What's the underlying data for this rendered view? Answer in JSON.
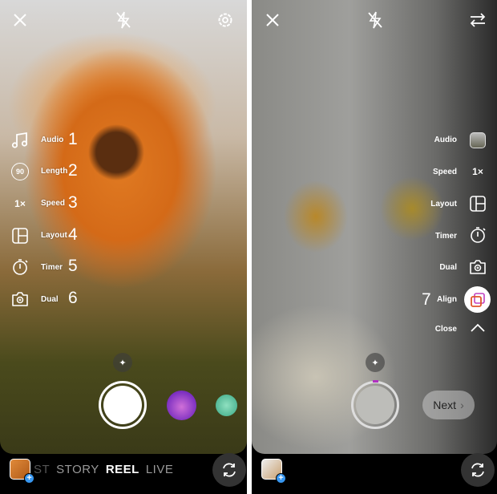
{
  "left": {
    "top_icons": [
      "close-icon",
      "flash-off-icon",
      "settings-icon"
    ],
    "tools": [
      {
        "icon": "music-note-icon",
        "label": "Audio",
        "number": "1"
      },
      {
        "icon": "length-icon",
        "icon_text": "90",
        "label": "Length",
        "number": "2"
      },
      {
        "icon": "speed-icon",
        "icon_text": "1×",
        "label": "Speed",
        "number": "3"
      },
      {
        "icon": "layout-icon",
        "label": "Layout",
        "number": "4"
      },
      {
        "icon": "timer-icon",
        "label": "Timer",
        "number": "5"
      },
      {
        "icon": "dual-camera-icon",
        "label": "Dual",
        "number": "6"
      }
    ],
    "modes": [
      "ST",
      "STORY",
      "REEL",
      "LIVE"
    ],
    "active_mode": "REEL"
  },
  "right": {
    "top_icons": [
      "close-icon",
      "flash-off-icon",
      "swap-arrows-icon"
    ],
    "tools": [
      {
        "icon": "audio-thumbnail-icon",
        "label": "Audio"
      },
      {
        "icon": "speed-icon",
        "icon_text": "1×",
        "label": "Speed"
      },
      {
        "icon": "layout-icon",
        "label": "Layout"
      },
      {
        "icon": "timer-icon",
        "label": "Timer"
      },
      {
        "icon": "dual-camera-icon",
        "label": "Dual"
      },
      {
        "icon": "align-icon",
        "label": "Align",
        "number": "7"
      },
      {
        "icon": "chevron-up-icon",
        "label": "Close"
      }
    ],
    "next_label": "Next",
    "next_chevron": "›"
  },
  "colors": {
    "plus_badge": "#3897f0",
    "align_accent": "#e0562b"
  }
}
